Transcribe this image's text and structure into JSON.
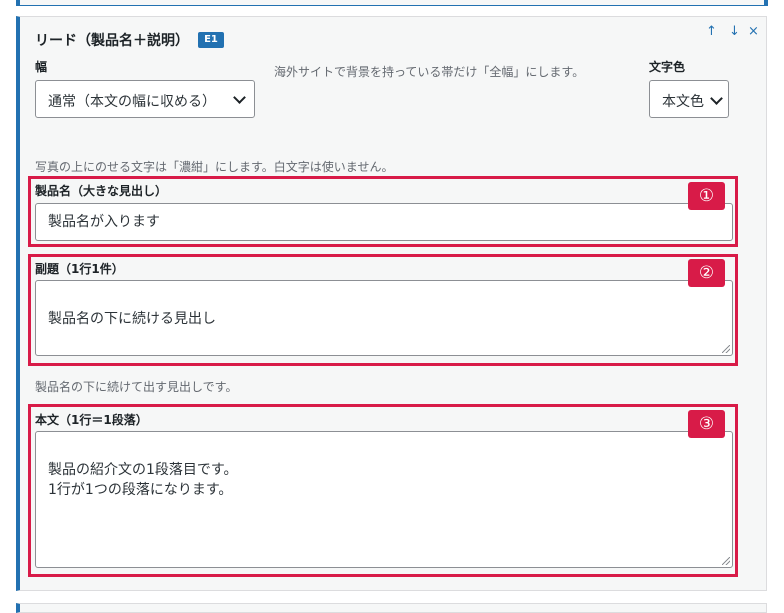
{
  "block": {
    "title": "リード（製品名＋説明）",
    "badge": "E1",
    "controls": {
      "up": "↑",
      "down": "↓",
      "close": "×"
    }
  },
  "width_setting": {
    "label": "幅",
    "value": "通常（本文の幅に収める）",
    "hint": "海外サイトで背景を持っている帯だけ「全幅」にします。"
  },
  "text_color": {
    "label": "文字色",
    "value": "本文色"
  },
  "photo_hint": "写真の上にのせる文字は「濃紺」にします。白文字は使いません。",
  "product_name": {
    "label": "製品名（大きな見出し）",
    "value": "製品名が入ります"
  },
  "subtitle": {
    "label": "副題（1行1件）",
    "value": "製品名の下に続ける見出し",
    "hint": "製品名の下に続けて出す見出しです。"
  },
  "body_text": {
    "label": "本文（1行＝1段落）",
    "value": "製品の紹介文の1段落目です。\n1行が1つの段落になります。"
  },
  "callouts": [
    "①",
    "②",
    "③"
  ],
  "colors": {
    "accent": "#2271b1",
    "highlight": "#d81b48"
  }
}
